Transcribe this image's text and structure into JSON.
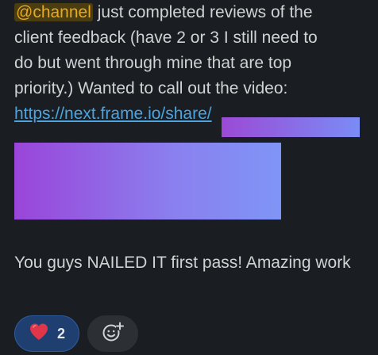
{
  "message": {
    "mention": "@channel",
    "line1_rest": " just completed reviews of the",
    "line2": "client feedback (have 2 or 3 I still need to",
    "line3": "do but went through mine that are top",
    "line4": "priority.) Wanted to call out the video:",
    "link_text": "https://next.frame.io/share/",
    "paragraph2": "You guys NAILED IT first pass! Amazing work"
  },
  "reactions": {
    "heart": {
      "icon": "heart-icon",
      "count": "2"
    },
    "add": {
      "icon": "add-emoji-icon"
    }
  },
  "colors": {
    "background": "#1a1d21",
    "text": "#d1d2d3",
    "mention_bg": "#4a3d11",
    "mention_text": "#e8a820",
    "link": "#4ba3e0",
    "reaction_bg": "#1f3f70"
  }
}
